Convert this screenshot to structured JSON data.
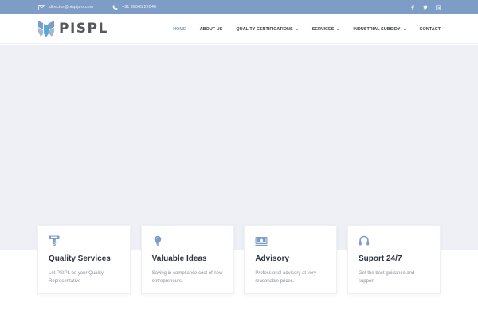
{
  "topbar": {
    "email": "director@pispipro.com",
    "phone": "+91 99045 22046",
    "social": [
      {
        "name": "facebook",
        "icon": "facebook-icon",
        "glyph": "f"
      },
      {
        "name": "twitter",
        "icon": "twitter-icon",
        "glyph": "t"
      },
      {
        "name": "linkedin",
        "icon": "linkedin-icon",
        "glyph": "in"
      }
    ]
  },
  "header": {
    "logo_text": "PISPL",
    "nav": [
      {
        "label": "HOME",
        "active": true,
        "dropdown": false
      },
      {
        "label": "ABOUT US",
        "active": false,
        "dropdown": false
      },
      {
        "label": "QUALITY CERTIFICATIONS",
        "active": false,
        "dropdown": true
      },
      {
        "label": "SERVICES",
        "active": false,
        "dropdown": true
      },
      {
        "label": "INDUSTRIAL SUBSIDY",
        "active": false,
        "dropdown": true
      },
      {
        "label": "CONTACT",
        "active": false,
        "dropdown": false
      }
    ]
  },
  "features": [
    {
      "icon": "stamp-icon",
      "title": "Quality Services",
      "desc": "Let PSIPL be your Quality Representative"
    },
    {
      "icon": "lightbulb-icon",
      "title": "Valuable Ideas",
      "desc": "Saving in compliance cost of new entrepreneurs."
    },
    {
      "icon": "money-icon",
      "title": "Advisory",
      "desc": "Professional advisory at very reasonable prices."
    },
    {
      "icon": "headset-icon",
      "title": "Suport 24/7",
      "desc": "Get the best guidance and support"
    }
  ],
  "colors": {
    "accent": "#7e9dc6",
    "topbar": "#7e9dc6",
    "hero": "#eef0f6",
    "heading": "#2d3340",
    "text": "#8b8f97"
  }
}
